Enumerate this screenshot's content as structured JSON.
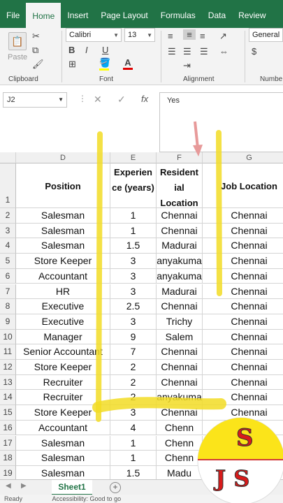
{
  "ribbon": {
    "tabs": [
      "File",
      "Home",
      "Insert",
      "Page Layout",
      "Formulas",
      "Data",
      "Review"
    ],
    "active_tab": "Home",
    "clipboard": {
      "label": "Clipboard",
      "paste_label": "Paste"
    },
    "font": {
      "label": "Font",
      "name": "Calibri",
      "size": "13",
      "bold": "B",
      "italic": "I",
      "underline": "U"
    },
    "alignment": {
      "label": "Alignment"
    },
    "number": {
      "label": "Numbe",
      "format": "General"
    },
    "colors": {
      "highlight": "#ffff00",
      "font_color": "#e00000",
      "accent": "#217346"
    }
  },
  "formula_bar": {
    "name_box": "J2",
    "fx": "fx",
    "value": "Yes"
  },
  "columns": [
    "D",
    "E",
    "F",
    "G"
  ],
  "headers": {
    "position": "Position",
    "experience": "Experien ce (years)",
    "residential": "Resident ial Location",
    "job": "Job Location"
  },
  "rows": [
    {
      "n": "2",
      "position": "Salesman",
      "exp": "1",
      "res": "Chennai",
      "job": "Chennai"
    },
    {
      "n": "3",
      "position": "Salesman",
      "exp": "1",
      "res": "Chennai",
      "job": "Chennai"
    },
    {
      "n": "4",
      "position": "Salesman",
      "exp": "1.5",
      "res": "Madurai",
      "job": "Chennai"
    },
    {
      "n": "5",
      "position": "Store Keeper",
      "exp": "3",
      "res": "anyakuma",
      "job": "Chennai"
    },
    {
      "n": "6",
      "position": "Accountant",
      "exp": "3",
      "res": "anyakuma",
      "job": "Chennai"
    },
    {
      "n": "7",
      "position": "HR",
      "exp": "3",
      "res": "Madurai",
      "job": "Chennai"
    },
    {
      "n": "8",
      "position": "Executive",
      "exp": "2.5",
      "res": "Chennai",
      "job": "Chennai"
    },
    {
      "n": "9",
      "position": "Executive",
      "exp": "3",
      "res": "Trichy",
      "job": "Chennai"
    },
    {
      "n": "10",
      "position": "Manager",
      "exp": "9",
      "res": "Salem",
      "job": "Chennai"
    },
    {
      "n": "11",
      "position": "Senior Accountant",
      "exp": "7",
      "res": "Chennai",
      "job": "Chennai"
    },
    {
      "n": "12",
      "position": "Store Keeper",
      "exp": "2",
      "res": "Chennai",
      "job": "Chennai"
    },
    {
      "n": "13",
      "position": "Recruiter",
      "exp": "2",
      "res": "Chennai",
      "job": "Chennai"
    },
    {
      "n": "14",
      "position": "Recruiter",
      "exp": "2",
      "res": "anyakuma",
      "job": "Chennai"
    },
    {
      "n": "15",
      "position": "Store Keeper",
      "exp": "3",
      "res": "Chennai",
      "job": "Chennai"
    },
    {
      "n": "16",
      "position": "Accountant",
      "exp": "4",
      "res": "Chenn",
      "job": ""
    },
    {
      "n": "17",
      "position": "Salesman",
      "exp": "1",
      "res": "Chenn",
      "job": ""
    },
    {
      "n": "18",
      "position": "Salesman",
      "exp": "1",
      "res": "Chenn",
      "job": ""
    },
    {
      "n": "19",
      "position": "Salesman",
      "exp": "1.5",
      "res": "Madu",
      "job": ""
    }
  ],
  "row1_label": "1",
  "sheet": {
    "tab": "Sheet1",
    "add": "+"
  },
  "status": {
    "ready": "Ready",
    "accessibility": "Accessibility: Good to go"
  },
  "logo": {
    "top": "S",
    "bottom": "J S"
  }
}
